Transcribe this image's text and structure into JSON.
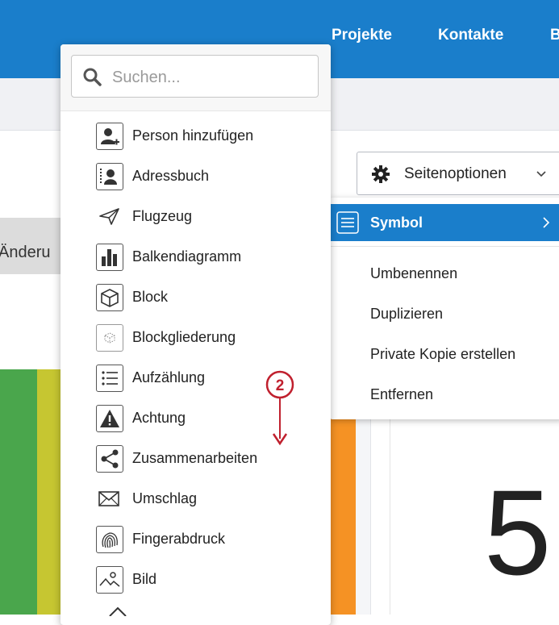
{
  "topnav": {
    "items": [
      "Projekte",
      "Kontakte",
      "B"
    ]
  },
  "tab": {
    "label": "Änderu"
  },
  "page_options": {
    "label": "Seitenoptionen",
    "icons": {
      "gear": "gear-icon",
      "chevron": "chevron-down-icon"
    }
  },
  "context_menu": {
    "active": {
      "label": "Symbol",
      "icon": "hamburger-icon"
    },
    "items": [
      "Umbenennen",
      "Duplizieren",
      "Private Kopie erstellen",
      "Entfernen"
    ]
  },
  "search": {
    "placeholder": "Suchen..."
  },
  "icon_list": [
    {
      "label": "Person hinzufügen",
      "icon": "add-person-icon"
    },
    {
      "label": "Adressbuch",
      "icon": "address-book-icon"
    },
    {
      "label": "Flugzeug",
      "icon": "paper-plane-icon"
    },
    {
      "label": "Balkendiagramm",
      "icon": "bar-chart-icon"
    },
    {
      "label": "Block",
      "icon": "cube-icon"
    },
    {
      "label": "Blockgliederung",
      "icon": "cube-outline-icon"
    },
    {
      "label": "Aufzählung",
      "icon": "bullet-list-icon"
    },
    {
      "label": "Achtung",
      "icon": "warning-icon"
    },
    {
      "label": "Zusammenarbeiten",
      "icon": "share-icon"
    },
    {
      "label": "Umschlag",
      "icon": "envelope-icon"
    },
    {
      "label": "Fingerabdruck",
      "icon": "fingerprint-icon"
    },
    {
      "label": "Bild",
      "icon": "image-icon"
    }
  ],
  "annotation": {
    "number": "2"
  },
  "metric": {
    "value": "5"
  },
  "colors": {
    "primary": "#1a7ecb",
    "annotation": "#c0202e",
    "green": "#4aa64c",
    "lime": "#c6c631",
    "orange": "#f59224"
  }
}
